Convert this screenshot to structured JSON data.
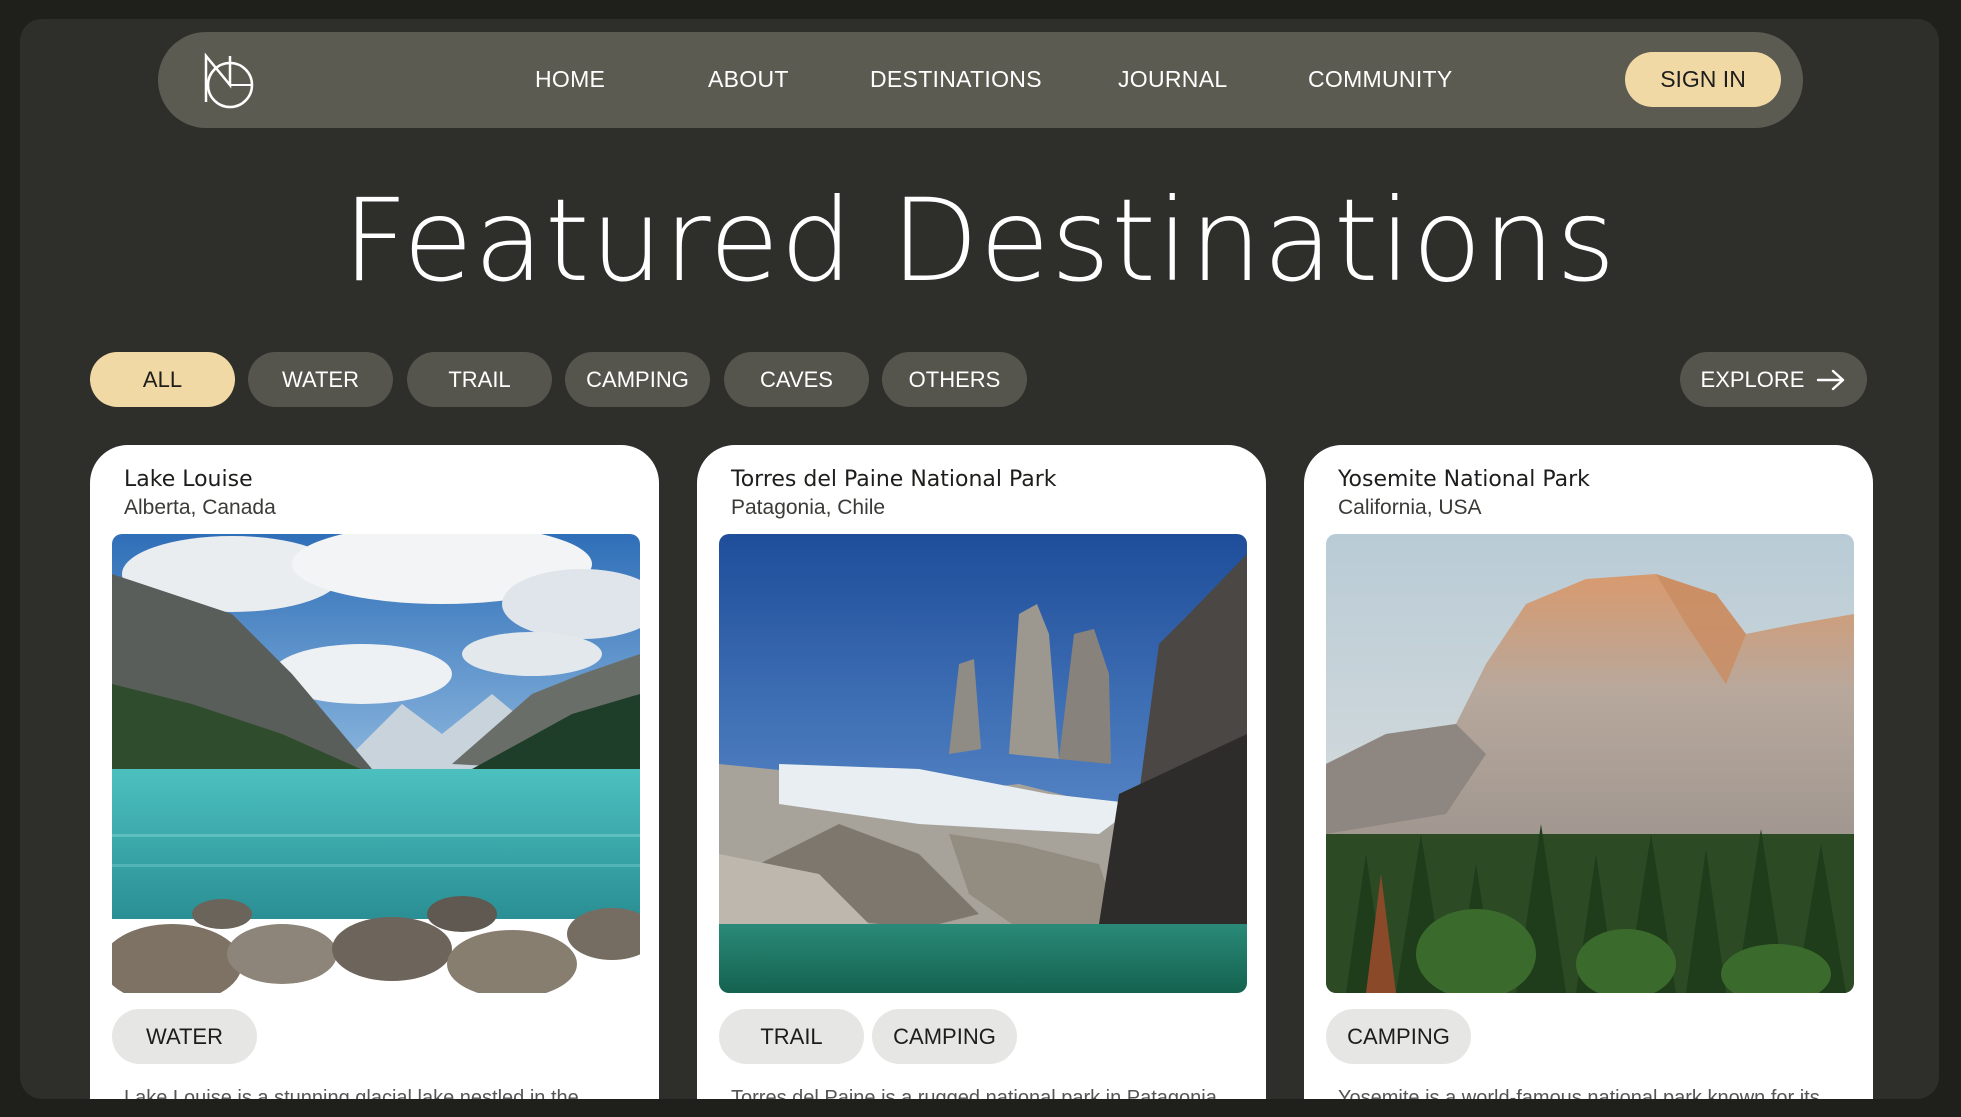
{
  "nav": {
    "links": [
      "HOME",
      "ABOUT",
      "DESTINATIONS",
      "JOURNAL",
      "COMMUNITY"
    ],
    "signin_label": "SIGN IN"
  },
  "hero": {
    "title": "Featured Destinations"
  },
  "filters": {
    "items": [
      "ALL",
      "WATER",
      "TRAIL",
      "CAMPING",
      "CAVES",
      "OTHERS"
    ],
    "active": "ALL",
    "explore_label": "EXPLORE"
  },
  "cards": [
    {
      "title": "Lake Louise",
      "location": "Alberta, Canada",
      "tags": [
        "WATER"
      ],
      "description": "Lake Louise is a stunning glacial lake nestled in the",
      "image_icon": "lake-mountain-image"
    },
    {
      "title": "Torres del Paine National Park",
      "location": "Patagonia, Chile",
      "tags": [
        "TRAIL",
        "CAMPING"
      ],
      "description": "Torres del Paine is a rugged national park in Patagonia",
      "image_icon": "granite-towers-image"
    },
    {
      "title": "Yosemite National Park",
      "location": "California, USA",
      "tags": [
        "CAMPING"
      ],
      "description": "Yosemite is a world-famous national park known for its",
      "image_icon": "half-dome-image"
    }
  ],
  "colors": {
    "background": "#2e2e2a",
    "nav": "#5c5b51",
    "accent": "#f0d9a5",
    "pill": "#55554d",
    "card": "#ffffff"
  }
}
